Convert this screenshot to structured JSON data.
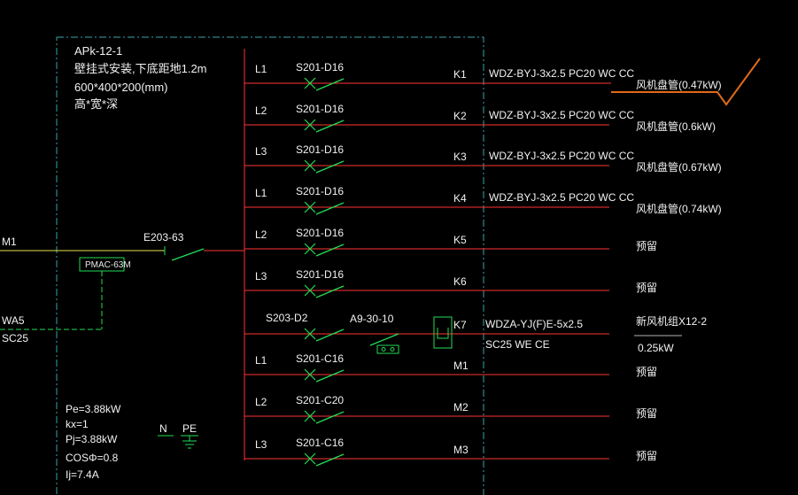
{
  "panel": {
    "name": "APk-12-1",
    "install": "壁挂式安装,下底距地1.2m",
    "size": "600*400*200(mm)",
    "size_note": "高*宽*深"
  },
  "incoming": {
    "feeder": "M1",
    "main_breaker": "E203-63",
    "meter": "PMAC-63M",
    "wa": "WA5",
    "sc": "SC25"
  },
  "circuits": [
    {
      "phase": "L1",
      "breaker": "S201-D16",
      "id": "K1",
      "cable": "WDZ-BYJ-3x2.5  PC20  WC CC",
      "load": "风机盘管(0.47kW)"
    },
    {
      "phase": "L2",
      "breaker": "S201-D16",
      "id": "K2",
      "cable": "WDZ-BYJ-3x2.5  PC20  WC CC",
      "load": "风机盘管(0.6kW)"
    },
    {
      "phase": "L3",
      "breaker": "S201-D16",
      "id": "K3",
      "cable": "WDZ-BYJ-3x2.5  PC20  WC CC",
      "load": "风机盘管(0.67kW)"
    },
    {
      "phase": "L1",
      "breaker": "S201-D16",
      "id": "K4",
      "cable": "WDZ-BYJ-3x2.5  PC20  WC CC",
      "load": "风机盘管(0.74kW)"
    },
    {
      "phase": "L2",
      "breaker": "S201-D16",
      "id": "K5",
      "cable": "",
      "load": "预留"
    },
    {
      "phase": "L3",
      "breaker": "S201-D16",
      "id": "K6",
      "cable": "",
      "load": "预留"
    },
    {
      "phase": "",
      "breaker": "S203-D2",
      "id": "K7",
      "cable": "WDZA-YJ(F)E-5x2.5",
      "load": "新风机组X12-2"
    },
    {
      "phase": "L1",
      "breaker": "S201-C16",
      "id": "M1",
      "cable": "",
      "load": "预留"
    },
    {
      "phase": "L2",
      "breaker": "S201-C20",
      "id": "M2",
      "cable": "",
      "load": "预留"
    },
    {
      "phase": "L3",
      "breaker": "S201-C16",
      "id": "M3",
      "cable": "",
      "load": "预留"
    }
  ],
  "k7_extra": {
    "contactor": "A9-30-10",
    "cable2": "SC25  WE  CE",
    "power": "0.25kW"
  },
  "summary": {
    "pe": "Pe=3.88kW",
    "kx": "kx=1",
    "pj": "Pj=3.88kW",
    "cos": "COSΦ=0.8",
    "ij": "Ij=7.4A"
  },
  "ground": {
    "n": "N",
    "pe": "PE"
  },
  "colors": {
    "background": "#000000",
    "bus": "#ff3333",
    "switch": "#22dd55",
    "cyan_frame": "#3aa6a6",
    "yellow_line": "#e6e64a",
    "orange_mark": "#e06a1a",
    "text": "#f2f2f2"
  }
}
